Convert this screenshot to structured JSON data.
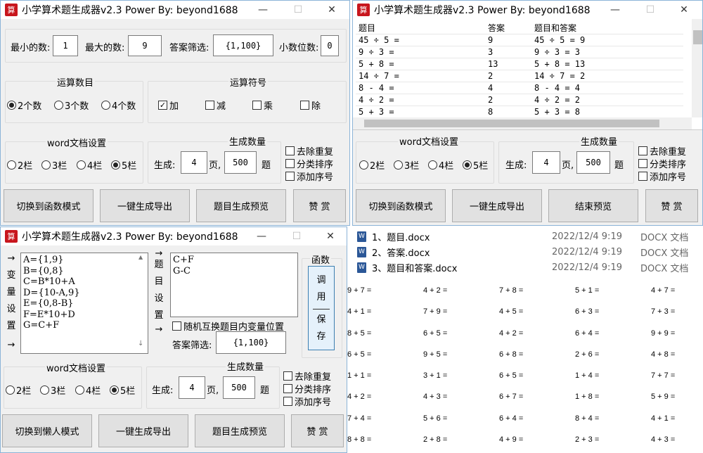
{
  "app_title": "小学算术题生成器v2.3   Power By:  beyond1688",
  "icon_glyph": "算",
  "controls": {
    "min": "—",
    "max": "☐",
    "close": "✕"
  },
  "w1": {
    "min_label": "最小的数:",
    "min_value": "1",
    "max_label": "最大的数:",
    "max_value": "9",
    "filter_label": "答案筛选:",
    "filter_value": "{1,100}",
    "decimal_label": "小数位数:",
    "decimal_value": "0",
    "ops_count_title": "运算数目",
    "ops_count": [
      "2个数",
      "3个数",
      "4个数"
    ],
    "ops_title": "运算符号",
    "ops": [
      {
        "label": "加",
        "checked": true
      },
      {
        "label": "减",
        "checked": false
      },
      {
        "label": "乘",
        "checked": false
      },
      {
        "label": "除",
        "checked": false
      }
    ],
    "word_title": "word文档设置",
    "cols": [
      "2栏",
      "3栏",
      "4栏",
      "5栏"
    ],
    "gen_title": "生成数量",
    "gen_label": "生成:",
    "pages_value": "4",
    "pages_unit": "页,",
    "questions_value": "500",
    "questions_unit": "题",
    "opts": [
      "去除重复",
      "分类排序",
      "添加序号"
    ],
    "buttons": [
      "切换到函数模式",
      "一键生成导出",
      "题目生成预览",
      "赞 赏"
    ]
  },
  "w2": {
    "headers": [
      "题目",
      "答案",
      "题目和答案"
    ],
    "rows": [
      [
        "45 ÷ 5 =",
        "9",
        "45 ÷ 5 = 9"
      ],
      [
        "9 ÷ 3 =",
        "3",
        "9 ÷ 3 = 3"
      ],
      [
        "5 + 8 =",
        "13",
        "5 + 8 = 13"
      ],
      [
        "14 ÷ 7 =",
        "2",
        "14 ÷ 7 = 2"
      ],
      [
        "8 - 4 =",
        "4",
        "8 - 4 = 4"
      ],
      [
        "4 ÷ 2 =",
        "2",
        "4 ÷ 2 = 2"
      ],
      [
        "5 + 3 =",
        "8",
        "5 + 3 = 8"
      ]
    ],
    "buttons": [
      "切换到函数模式",
      "一键生成导出",
      "结束预览",
      "赞 赏"
    ]
  },
  "w3": {
    "arrow": "→",
    "arrow_down": "↓",
    "var_label": [
      "变",
      "量",
      "设",
      "置"
    ],
    "variables": [
      "A={1,9}",
      "B={0,8}",
      "C=B*10+A",
      "D={10-A,9}",
      "E={0,8-B}",
      "F=E*10+D",
      "G=C+F"
    ],
    "q_label": [
      "题",
      "目",
      "设",
      "置"
    ],
    "questions": [
      "C+F",
      "G-C"
    ],
    "swap_label": "随机互换题目内变量位置",
    "filter_label": "答案筛选:",
    "filter_value": "{1,100}",
    "func_title": "函数",
    "func_btn": [
      "调",
      "用"
    ],
    "save_btn": [
      "保",
      "存"
    ],
    "buttons": [
      "切换到懒人模式",
      "一键生成导出",
      "题目生成预览",
      "赞 赏"
    ]
  },
  "files": [
    {
      "name": "1、题目.docx",
      "date": "2022/12/4 9:19",
      "type": "DOCX 文档"
    },
    {
      "name": "2、答案.docx",
      "date": "2022/12/4 9:19",
      "type": "DOCX 文档"
    },
    {
      "name": "3、题目和答案.docx",
      "date": "2022/12/4 9:19",
      "type": "DOCX 文档"
    }
  ],
  "doc_icon": "W",
  "problems": [
    "9 + 7 =",
    "4 + 2 =",
    "7 + 8 =",
    "5 + 1 =",
    "4 + 7 =",
    "4 + 1 =",
    "7 + 9 =",
    "4 + 5 =",
    "6 + 3 =",
    "7 + 3 =",
    "8 + 5 =",
    "6 + 5 =",
    "4 + 2 =",
    "6 + 4 =",
    "9 + 9 =",
    "6 + 5 =",
    "9 + 5 =",
    "6 + 8 =",
    "2 + 6 =",
    "4 + 8 =",
    "1 + 1 =",
    "3 + 1 =",
    "6 + 5 =",
    "1 + 4 =",
    "7 + 7 =",
    "4 + 2 =",
    "4 + 3 =",
    "6 + 7 =",
    "1 + 8 =",
    "5 + 9 =",
    "7 + 4 =",
    "5 + 6 =",
    "6 + 4 =",
    "8 + 4 =",
    "4 + 1 =",
    "8 + 8 =",
    "2 + 8 =",
    "4 + 9 =",
    "2 + 3 =",
    "4 + 3 ="
  ]
}
